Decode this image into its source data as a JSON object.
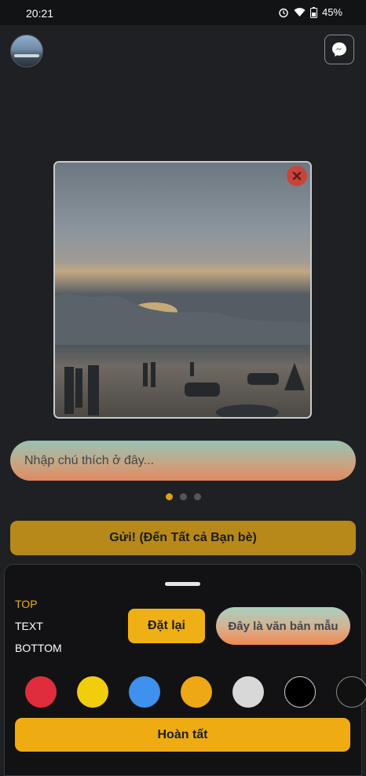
{
  "status": {
    "time": "20:21",
    "battery": "45%"
  },
  "caption": {
    "placeholder": "Nhập chú thích ở đây..."
  },
  "pager": {
    "count": 3,
    "active": 1
  },
  "send_button": "Gửi! (Đến Tất cả Bạn bè)",
  "sheet": {
    "positions": [
      "TOP",
      "TEXT",
      "BOTTOM"
    ],
    "selected_position": "TOP",
    "reset_label": "Đặt lại",
    "sample_text": "Đây là văn bản mẫu",
    "colors": [
      "#e02d3c",
      "#f0ce0c",
      "#3f90ef",
      "#eea813",
      "#d8d8d8",
      "#000000",
      "#111111"
    ],
    "done_label": "Hoàn tất"
  },
  "accent": "#eeb014"
}
